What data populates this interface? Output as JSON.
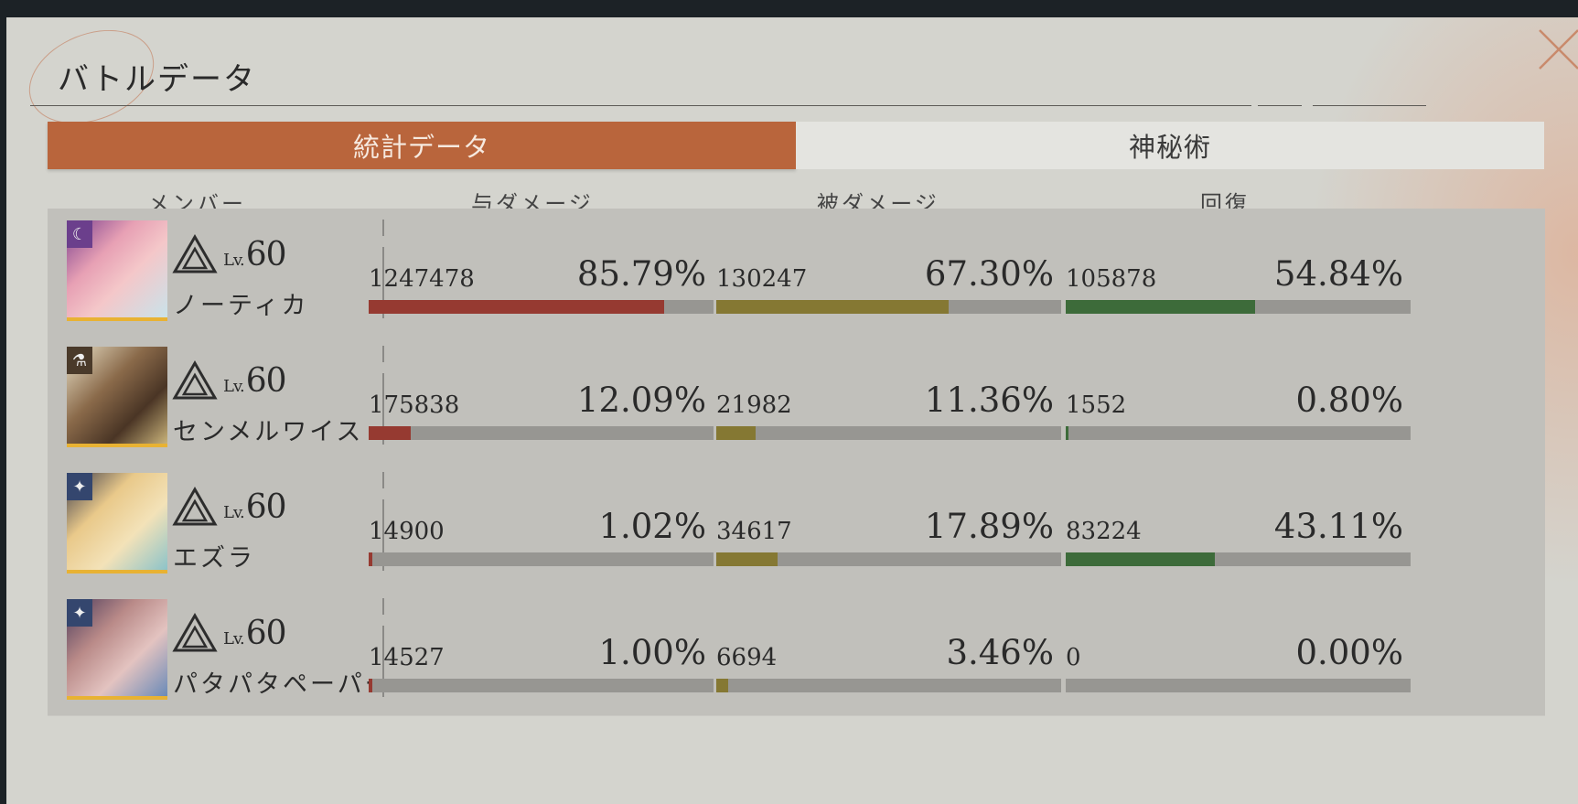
{
  "window": {
    "title": "バトルデータ"
  },
  "tabs": [
    {
      "label": "統計データ",
      "active": true
    },
    {
      "label": "神秘術",
      "active": false
    }
  ],
  "columns": {
    "member": "メンバー",
    "damage_dealt": "与ダメージ",
    "damage_taken": "被ダメージ",
    "healing": "回復"
  },
  "level_prefix": "Lv.",
  "colors": {
    "accent": "#b9653c",
    "damage_dealt_bar": "#963a31",
    "damage_taken_bar": "#857833",
    "healing_bar": "#3d6b3a",
    "bar_track": "#979692"
  },
  "members": [
    {
      "name": "ノーティカ",
      "level": "60",
      "class_icon": "crescent-moon-icon",
      "damage_dealt": {
        "value": "1247478",
        "percent": "85.79%",
        "fraction": 0.8579
      },
      "damage_taken": {
        "value": "130247",
        "percent": "67.30%",
        "fraction": 0.673
      },
      "healing": {
        "value": "105878",
        "percent": "54.84%",
        "fraction": 0.5484
      }
    },
    {
      "name": "センメルワイス",
      "level": "60",
      "class_icon": "mortar-icon",
      "damage_dealt": {
        "value": "175838",
        "percent": "12.09%",
        "fraction": 0.1209
      },
      "damage_taken": {
        "value": "21982",
        "percent": "11.36%",
        "fraction": 0.1136
      },
      "healing": {
        "value": "1552",
        "percent": "0.80%",
        "fraction": 0.008
      }
    },
    {
      "name": "エズラ",
      "level": "60",
      "class_icon": "star-sparkle-icon",
      "damage_dealt": {
        "value": "14900",
        "percent": "1.02%",
        "fraction": 0.0102
      },
      "damage_taken": {
        "value": "34617",
        "percent": "17.89%",
        "fraction": 0.1789
      },
      "healing": {
        "value": "83224",
        "percent": "43.11%",
        "fraction": 0.4311
      }
    },
    {
      "name": "パタパタペーパー",
      "level": "60",
      "class_icon": "star-sparkle-icon",
      "damage_dealt": {
        "value": "14527",
        "percent": "1.00%",
        "fraction": 0.01
      },
      "damage_taken": {
        "value": "6694",
        "percent": "3.46%",
        "fraction": 0.0346
      },
      "healing": {
        "value": "0",
        "percent": "0.00%",
        "fraction": 0.0
      }
    }
  ]
}
